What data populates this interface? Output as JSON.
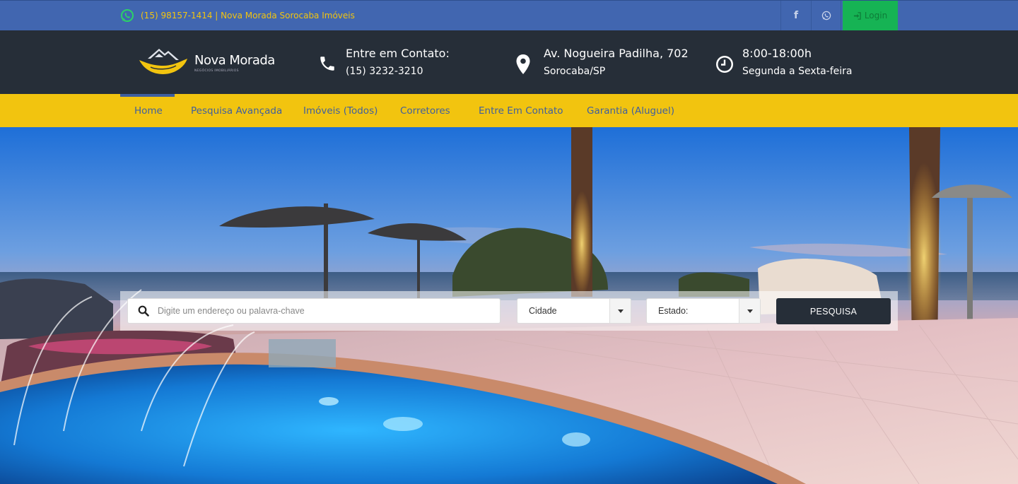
{
  "topbar": {
    "phone_text": "(15) 98157-1414 | Nova Morada Sorocaba Imóveis",
    "login_label": "Login",
    "colors": {
      "background": "#4166b0",
      "accent": "#f2c40f",
      "login_bg": "#16b354"
    }
  },
  "header": {
    "logo_name": "Nova Morada",
    "logo_tagline": "NEGÓCIOS IMOBILIÁRIOS",
    "contact": {
      "line1": "Entre em Contato:",
      "line2": "(15) 3232-3210"
    },
    "address": {
      "line1": "Av. Nogueira Padilha, 702",
      "line2": "Sorocaba/SP"
    },
    "hours": {
      "line1": "8:00-18:00h",
      "line2": "Segunda a Sexta-feira"
    },
    "colors": {
      "background": "#262e38"
    }
  },
  "nav": {
    "items": [
      {
        "label": "Home"
      },
      {
        "label": "Pesquisa Avançada"
      },
      {
        "label": "Imóveis (Todos)"
      },
      {
        "label": "Corretores"
      },
      {
        "label": "Entre Em Contato"
      },
      {
        "label": "Garantia (Aluguel)"
      }
    ],
    "active": "Home",
    "colors": {
      "background": "#f2c40f",
      "text": "#3f5f9f"
    }
  },
  "search": {
    "placeholder": "Digite um endereço ou palavra-chave",
    "city_selected": "Cidade",
    "state_selected": "Estado:",
    "submit_label": "PESQUISA"
  },
  "icons": [
    "whatsapp-icon",
    "facebook-icon",
    "whatsapp-icon",
    "sign-in-icon",
    "phone-icon",
    "map-pin-icon",
    "clock-icon",
    "search-icon",
    "caret-down-icon"
  ]
}
